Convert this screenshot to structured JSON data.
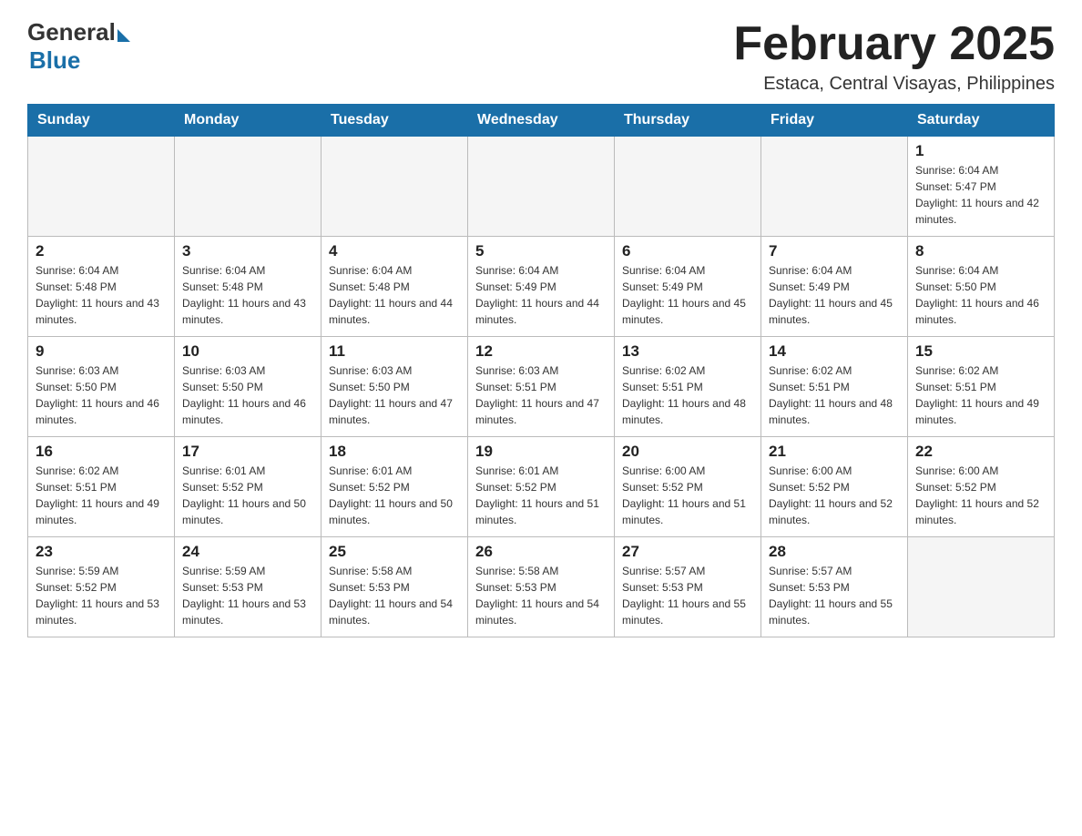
{
  "header": {
    "logo_general": "General",
    "logo_blue": "Blue",
    "title": "February 2025",
    "subtitle": "Estaca, Central Visayas, Philippines"
  },
  "days_of_week": [
    "Sunday",
    "Monday",
    "Tuesday",
    "Wednesday",
    "Thursday",
    "Friday",
    "Saturday"
  ],
  "weeks": [
    [
      {
        "day": "",
        "sunrise": "",
        "sunset": "",
        "daylight": "",
        "empty": true
      },
      {
        "day": "",
        "sunrise": "",
        "sunset": "",
        "daylight": "",
        "empty": true
      },
      {
        "day": "",
        "sunrise": "",
        "sunset": "",
        "daylight": "",
        "empty": true
      },
      {
        "day": "",
        "sunrise": "",
        "sunset": "",
        "daylight": "",
        "empty": true
      },
      {
        "day": "",
        "sunrise": "",
        "sunset": "",
        "daylight": "",
        "empty": true
      },
      {
        "day": "",
        "sunrise": "",
        "sunset": "",
        "daylight": "",
        "empty": true
      },
      {
        "day": "1",
        "sunrise": "Sunrise: 6:04 AM",
        "sunset": "Sunset: 5:47 PM",
        "daylight": "Daylight: 11 hours and 42 minutes.",
        "empty": false
      }
    ],
    [
      {
        "day": "2",
        "sunrise": "Sunrise: 6:04 AM",
        "sunset": "Sunset: 5:48 PM",
        "daylight": "Daylight: 11 hours and 43 minutes.",
        "empty": false
      },
      {
        "day": "3",
        "sunrise": "Sunrise: 6:04 AM",
        "sunset": "Sunset: 5:48 PM",
        "daylight": "Daylight: 11 hours and 43 minutes.",
        "empty": false
      },
      {
        "day": "4",
        "sunrise": "Sunrise: 6:04 AM",
        "sunset": "Sunset: 5:48 PM",
        "daylight": "Daylight: 11 hours and 44 minutes.",
        "empty": false
      },
      {
        "day": "5",
        "sunrise": "Sunrise: 6:04 AM",
        "sunset": "Sunset: 5:49 PM",
        "daylight": "Daylight: 11 hours and 44 minutes.",
        "empty": false
      },
      {
        "day": "6",
        "sunrise": "Sunrise: 6:04 AM",
        "sunset": "Sunset: 5:49 PM",
        "daylight": "Daylight: 11 hours and 45 minutes.",
        "empty": false
      },
      {
        "day": "7",
        "sunrise": "Sunrise: 6:04 AM",
        "sunset": "Sunset: 5:49 PM",
        "daylight": "Daylight: 11 hours and 45 minutes.",
        "empty": false
      },
      {
        "day": "8",
        "sunrise": "Sunrise: 6:04 AM",
        "sunset": "Sunset: 5:50 PM",
        "daylight": "Daylight: 11 hours and 46 minutes.",
        "empty": false
      }
    ],
    [
      {
        "day": "9",
        "sunrise": "Sunrise: 6:03 AM",
        "sunset": "Sunset: 5:50 PM",
        "daylight": "Daylight: 11 hours and 46 minutes.",
        "empty": false
      },
      {
        "day": "10",
        "sunrise": "Sunrise: 6:03 AM",
        "sunset": "Sunset: 5:50 PM",
        "daylight": "Daylight: 11 hours and 46 minutes.",
        "empty": false
      },
      {
        "day": "11",
        "sunrise": "Sunrise: 6:03 AM",
        "sunset": "Sunset: 5:50 PM",
        "daylight": "Daylight: 11 hours and 47 minutes.",
        "empty": false
      },
      {
        "day": "12",
        "sunrise": "Sunrise: 6:03 AM",
        "sunset": "Sunset: 5:51 PM",
        "daylight": "Daylight: 11 hours and 47 minutes.",
        "empty": false
      },
      {
        "day": "13",
        "sunrise": "Sunrise: 6:02 AM",
        "sunset": "Sunset: 5:51 PM",
        "daylight": "Daylight: 11 hours and 48 minutes.",
        "empty": false
      },
      {
        "day": "14",
        "sunrise": "Sunrise: 6:02 AM",
        "sunset": "Sunset: 5:51 PM",
        "daylight": "Daylight: 11 hours and 48 minutes.",
        "empty": false
      },
      {
        "day": "15",
        "sunrise": "Sunrise: 6:02 AM",
        "sunset": "Sunset: 5:51 PM",
        "daylight": "Daylight: 11 hours and 49 minutes.",
        "empty": false
      }
    ],
    [
      {
        "day": "16",
        "sunrise": "Sunrise: 6:02 AM",
        "sunset": "Sunset: 5:51 PM",
        "daylight": "Daylight: 11 hours and 49 minutes.",
        "empty": false
      },
      {
        "day": "17",
        "sunrise": "Sunrise: 6:01 AM",
        "sunset": "Sunset: 5:52 PM",
        "daylight": "Daylight: 11 hours and 50 minutes.",
        "empty": false
      },
      {
        "day": "18",
        "sunrise": "Sunrise: 6:01 AM",
        "sunset": "Sunset: 5:52 PM",
        "daylight": "Daylight: 11 hours and 50 minutes.",
        "empty": false
      },
      {
        "day": "19",
        "sunrise": "Sunrise: 6:01 AM",
        "sunset": "Sunset: 5:52 PM",
        "daylight": "Daylight: 11 hours and 51 minutes.",
        "empty": false
      },
      {
        "day": "20",
        "sunrise": "Sunrise: 6:00 AM",
        "sunset": "Sunset: 5:52 PM",
        "daylight": "Daylight: 11 hours and 51 minutes.",
        "empty": false
      },
      {
        "day": "21",
        "sunrise": "Sunrise: 6:00 AM",
        "sunset": "Sunset: 5:52 PM",
        "daylight": "Daylight: 11 hours and 52 minutes.",
        "empty": false
      },
      {
        "day": "22",
        "sunrise": "Sunrise: 6:00 AM",
        "sunset": "Sunset: 5:52 PM",
        "daylight": "Daylight: 11 hours and 52 minutes.",
        "empty": false
      }
    ],
    [
      {
        "day": "23",
        "sunrise": "Sunrise: 5:59 AM",
        "sunset": "Sunset: 5:52 PM",
        "daylight": "Daylight: 11 hours and 53 minutes.",
        "empty": false
      },
      {
        "day": "24",
        "sunrise": "Sunrise: 5:59 AM",
        "sunset": "Sunset: 5:53 PM",
        "daylight": "Daylight: 11 hours and 53 minutes.",
        "empty": false
      },
      {
        "day": "25",
        "sunrise": "Sunrise: 5:58 AM",
        "sunset": "Sunset: 5:53 PM",
        "daylight": "Daylight: 11 hours and 54 minutes.",
        "empty": false
      },
      {
        "day": "26",
        "sunrise": "Sunrise: 5:58 AM",
        "sunset": "Sunset: 5:53 PM",
        "daylight": "Daylight: 11 hours and 54 minutes.",
        "empty": false
      },
      {
        "day": "27",
        "sunrise": "Sunrise: 5:57 AM",
        "sunset": "Sunset: 5:53 PM",
        "daylight": "Daylight: 11 hours and 55 minutes.",
        "empty": false
      },
      {
        "day": "28",
        "sunrise": "Sunrise: 5:57 AM",
        "sunset": "Sunset: 5:53 PM",
        "daylight": "Daylight: 11 hours and 55 minutes.",
        "empty": false
      },
      {
        "day": "",
        "sunrise": "",
        "sunset": "",
        "daylight": "",
        "empty": true
      }
    ]
  ]
}
